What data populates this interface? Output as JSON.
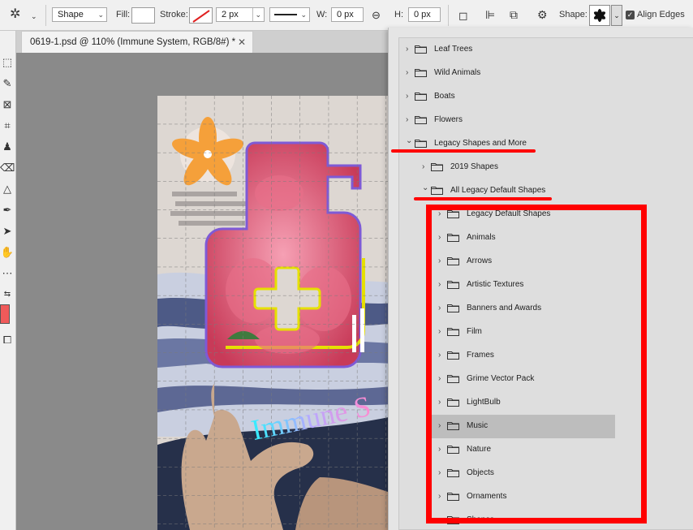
{
  "options_bar": {
    "mode_value": "Shape",
    "fill_label": "Fill:",
    "stroke_label": "Stroke:",
    "stroke_width": "2 px",
    "w_label": "W:",
    "w_value": "0 px",
    "h_label": "H:",
    "h_value": "0 px",
    "shape_label": "Shape:",
    "align_edges_label": "Align Edges",
    "align_edges_checked": true
  },
  "document": {
    "tab_title": "0619-1.psd @ 110% (Immune System, RGB/8#) *",
    "canvas_text": "Immune S",
    "foreground_color": "#f05a5a"
  },
  "shape_panel": {
    "items": [
      {
        "name": "Leaf Trees",
        "level": 0,
        "expanded": false
      },
      {
        "name": "Wild Animals",
        "level": 0,
        "expanded": false
      },
      {
        "name": "Boats",
        "level": 0,
        "expanded": false
      },
      {
        "name": "Flowers",
        "level": 0,
        "expanded": false
      },
      {
        "name": "Legacy Shapes and More",
        "level": 0,
        "expanded": true
      },
      {
        "name": "2019 Shapes",
        "level": 1,
        "expanded": false
      },
      {
        "name": "All Legacy Default Shapes",
        "level": 1,
        "expanded": true
      },
      {
        "name": "Legacy Default Shapes",
        "level": 2,
        "expanded": false
      },
      {
        "name": "Animals",
        "level": 2,
        "expanded": false
      },
      {
        "name": "Arrows",
        "level": 2,
        "expanded": false
      },
      {
        "name": "Artistic Textures",
        "level": 2,
        "expanded": false
      },
      {
        "name": "Banners and Awards",
        "level": 2,
        "expanded": false
      },
      {
        "name": "Film",
        "level": 2,
        "expanded": false
      },
      {
        "name": "Frames",
        "level": 2,
        "expanded": false
      },
      {
        "name": "Grime Vector Pack",
        "level": 2,
        "expanded": false
      },
      {
        "name": "LightBulb",
        "level": 2,
        "expanded": false
      },
      {
        "name": "Music",
        "level": 2,
        "expanded": false,
        "selected": true
      },
      {
        "name": "Nature",
        "level": 2,
        "expanded": false
      },
      {
        "name": "Objects",
        "level": 2,
        "expanded": false
      },
      {
        "name": "Ornaments",
        "level": 2,
        "expanded": false
      },
      {
        "name": "Shapes",
        "level": 2,
        "expanded": false
      }
    ]
  },
  "annotation_color": "#ff0000"
}
